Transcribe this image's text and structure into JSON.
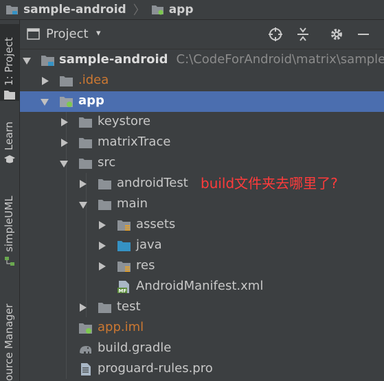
{
  "breadcrumb": [
    {
      "label": "sample-android",
      "icon": "module-folder-icon"
    },
    {
      "label": "app",
      "icon": "module-folder-icon"
    }
  ],
  "stripe": {
    "project": "1: Project",
    "learn": "Learn",
    "simpleuml": "simpleUML",
    "source_manager": "ource Manager"
  },
  "panel": {
    "view_title": "Project",
    "caret": "▾"
  },
  "tree": {
    "root_label": "sample-android",
    "root_path": "C:\\CodeForAndroid\\matrix\\samples\\",
    "idea": ".idea",
    "app": "app",
    "keystore": "keystore",
    "matrixTrace": "matrixTrace",
    "src": "src",
    "androidTest": "androidTest",
    "main": "main",
    "assets": "assets",
    "java": "java",
    "res": "res",
    "manifest": "AndroidManifest.xml",
    "test": "test",
    "app_iml": "app.iml",
    "build_gradle": "build.gradle",
    "proguard": "proguard-rules.pro"
  },
  "annotation": "build文件夹去哪里了?",
  "colors": {
    "background": "#3c3f41",
    "selection": "#4b6eaf",
    "annotation": "#ff3b3b",
    "excluded": "#cc7832"
  }
}
